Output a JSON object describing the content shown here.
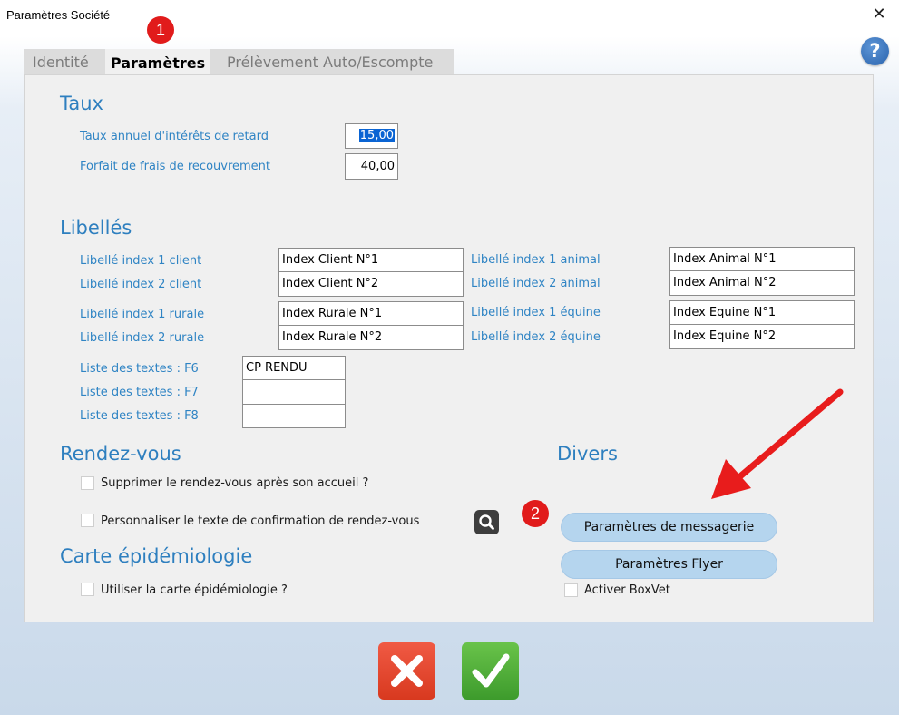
{
  "window": {
    "title": "Paramètres Société",
    "close_symbol": "✕",
    "help_symbol": "?"
  },
  "badges": {
    "one": "1",
    "two": "2"
  },
  "tabs": [
    {
      "label": "Identité",
      "active": false
    },
    {
      "label": "Paramètres",
      "active": true
    },
    {
      "label": "Prélèvement Auto/Escompte",
      "active": false
    }
  ],
  "taux": {
    "heading": "Taux",
    "interets_label": "Taux annuel d'intérêts de retard",
    "interets_value": "15,00",
    "forfait_label": "Forfait de frais de recouvrement",
    "forfait_value": "40,00"
  },
  "libelles": {
    "heading": "Libellés",
    "left": [
      {
        "label": "Libellé index 1 client",
        "value": "Index Client N°1"
      },
      {
        "label": "Libellé index 2 client",
        "value": "Index Client N°2"
      },
      {
        "label": "Libellé index 1 rurale",
        "value": "Index Rurale N°1"
      },
      {
        "label": "Libellé index 2 rurale",
        "value": "Index Rurale N°2"
      }
    ],
    "right": [
      {
        "label": "Libellé index 1 animal",
        "value": "Index Animal N°1"
      },
      {
        "label": "Libellé index 2 animal",
        "value": "Index Animal N°2"
      },
      {
        "label": "Libellé index 1 équine",
        "value": "Index Equine N°1"
      },
      {
        "label": "Libellé index 2 équine",
        "value": "Index Equine N°2"
      }
    ],
    "textes": [
      {
        "label": "Liste des textes  : F6",
        "value": "CP RENDU"
      },
      {
        "label": "Liste des textes  : F7",
        "value": ""
      },
      {
        "label": "Liste des textes  : F8",
        "value": ""
      }
    ]
  },
  "rendezvous": {
    "heading": "Rendez-vous",
    "supprimer_label": "Supprimer le rendez-vous après son accueil ?",
    "supprimer_checked": false,
    "personnaliser_label": "Personnaliser le texte de confirmation de rendez-vous",
    "personnaliser_checked": false
  },
  "carte": {
    "heading": "Carte épidémiologie",
    "utiliser_label": "Utiliser la carte épidémiologie ?",
    "utiliser_checked": false
  },
  "divers": {
    "heading": "Divers",
    "messagerie_button": "Paramètres de messagerie",
    "flyer_button": "Paramètres Flyer",
    "boxvet_label": "Activer BoxVet",
    "boxvet_checked": false
  },
  "icons": {
    "search": "search-icon",
    "cancel": "close-icon",
    "confirm": "check-icon",
    "arrow": "arrow-icon"
  },
  "colors": {
    "section_heading": "#2e7fbf",
    "label": "#2f84c4",
    "badge": "#e11b1b",
    "pill_button": "#b5d5ee",
    "cancel": "#e0452b",
    "confirm": "#4caf3a",
    "selection": "#0a64d3"
  }
}
